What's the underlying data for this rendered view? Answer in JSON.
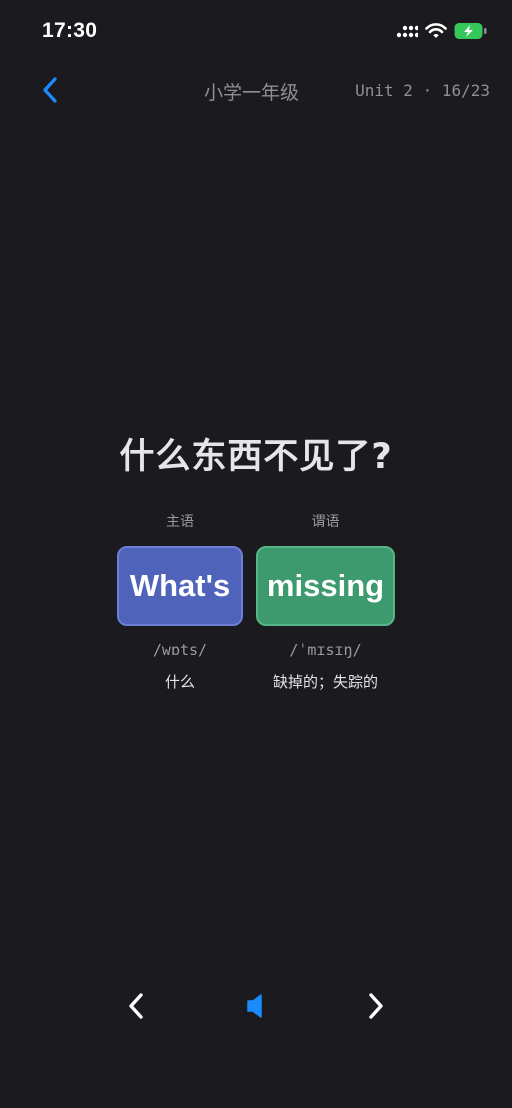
{
  "status_bar": {
    "time": "17:30",
    "icons": [
      "signal-icon",
      "wifi-icon",
      "battery-charging-icon"
    ]
  },
  "header": {
    "back_icon": "chevron-left-icon",
    "course_title": "小学一年级",
    "unit_progress": "Unit 2 · 16/23"
  },
  "lesson": {
    "prompt": "什么东西不见了?",
    "words": [
      {
        "role": "主语",
        "word": "What's",
        "phonetic": "/wɒts/",
        "meaning": "什么",
        "color": "#4f63bb"
      },
      {
        "role": "谓语",
        "word": "missing",
        "phonetic": "/ˈmɪsɪŋ/",
        "meaning": "缺掉的；失踪的",
        "color": "#3c9a6e"
      }
    ]
  },
  "controls": {
    "prev_icon": "chevron-left-icon",
    "audio_icon": "speaker-icon",
    "next_icon": "chevron-right-icon"
  },
  "colors": {
    "background": "#1b1b1f",
    "accent": "#1a8cff",
    "battery": "#35c759"
  }
}
